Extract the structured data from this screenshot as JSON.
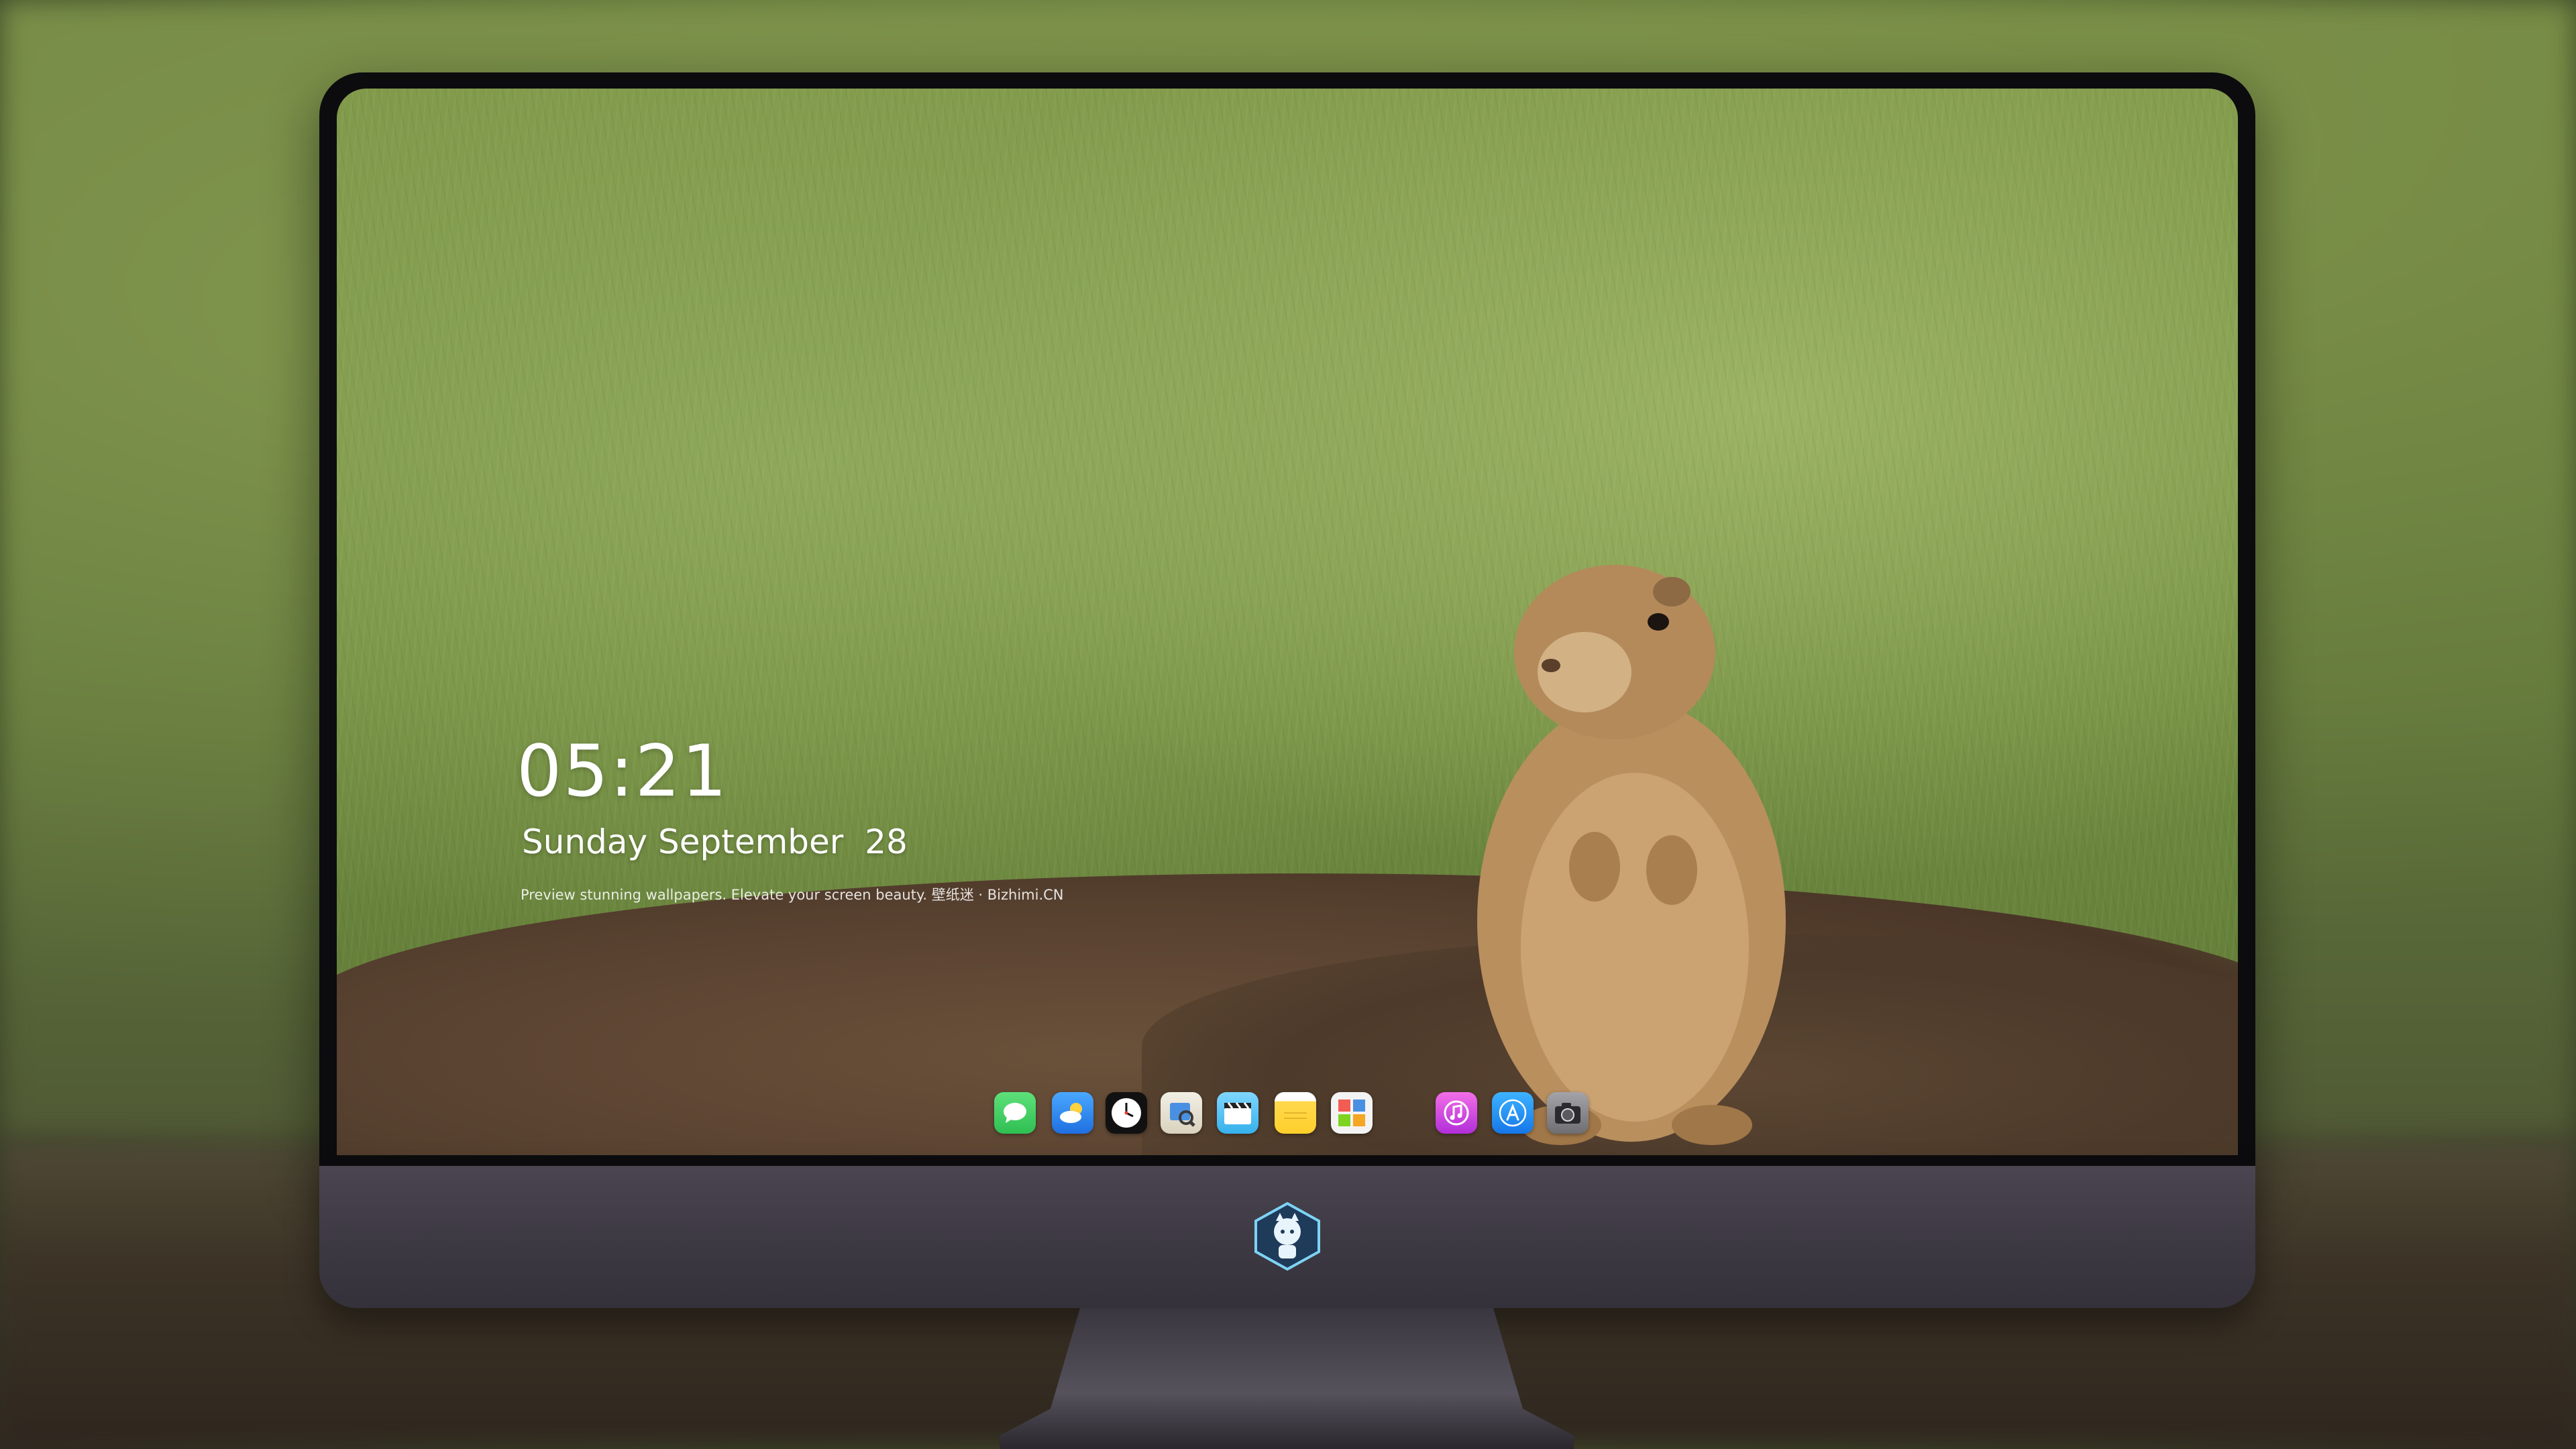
{
  "lock_screen": {
    "time": "05:21",
    "date": "Sunday September  28",
    "caption": "Preview stunning wallpapers. Elevate your screen beauty. 壁纸迷 · Bizhimi.CN"
  },
  "dock": {
    "icons": [
      {
        "name": "messages-icon",
        "color": "#34c759"
      },
      {
        "name": "weather-icon",
        "color": "#2f8ef0"
      },
      {
        "name": "clock-icon",
        "color": "#1c1c1e"
      },
      {
        "name": "preview-icon",
        "color": "#e8e3d6"
      },
      {
        "name": "clips-icon",
        "color": "#5ac8fa"
      },
      {
        "name": "notes-icon",
        "color": "#ffd84d"
      },
      {
        "name": "photo-booth-icon",
        "color": "#f2f2f2"
      },
      {
        "name": "itunes-icon",
        "color": "#d94ae0"
      },
      {
        "name": "app-store-icon",
        "color": "#1d8ff2"
      },
      {
        "name": "camera-icon",
        "color": "#8e8e93"
      }
    ]
  },
  "colors": {
    "monitor_bezel": "#0c0c0e",
    "monitor_chin": "#3e3a44",
    "lock_text": "#ffffff"
  }
}
